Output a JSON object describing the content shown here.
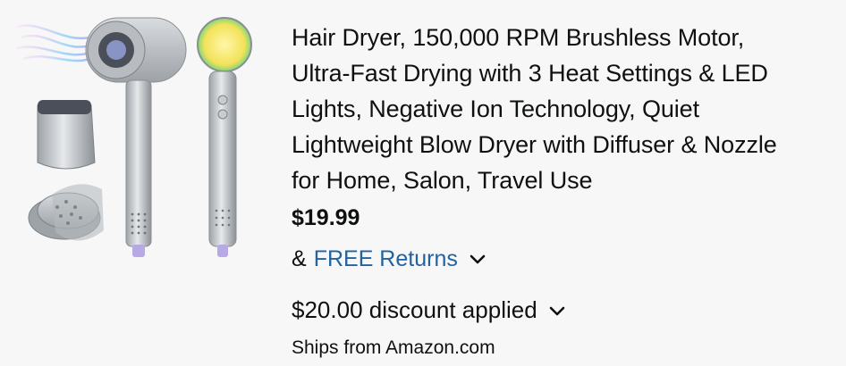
{
  "product": {
    "image_alt": "hair-dryer-product-image",
    "title": "Hair Dryer, 150,000 RPM Brushless Motor, Ultra-Fast Drying with 3 Heat Settings & LED Lights, Negative Ion Technology, Quiet Lightweight Blow Dryer with Diffuser & Nozzle for Home, Salon, Travel Use",
    "title_lines": [
      "Hair Dryer, 150,000 RPM Brushless Motor,",
      "Ultra-Fast Drying with 3 Heat Settings & LED",
      "Lights, Negative Ion Technology, Quiet",
      "Lightweight Blow Dryer with Diffuser & Nozzle",
      "for Home, Salon, Travel Use"
    ],
    "price": "$19.99",
    "returns_prefix": "&",
    "returns_label": "FREE Returns",
    "returns_icon": "chevron-down-icon",
    "discount_label": "$20.00 discount applied",
    "discount_icon": "chevron-down-icon",
    "shipping": "Ships from Amazon.com"
  },
  "colors": {
    "link": "#2162a1",
    "text": "#0f1111",
    "background": "#f7f7f7"
  }
}
